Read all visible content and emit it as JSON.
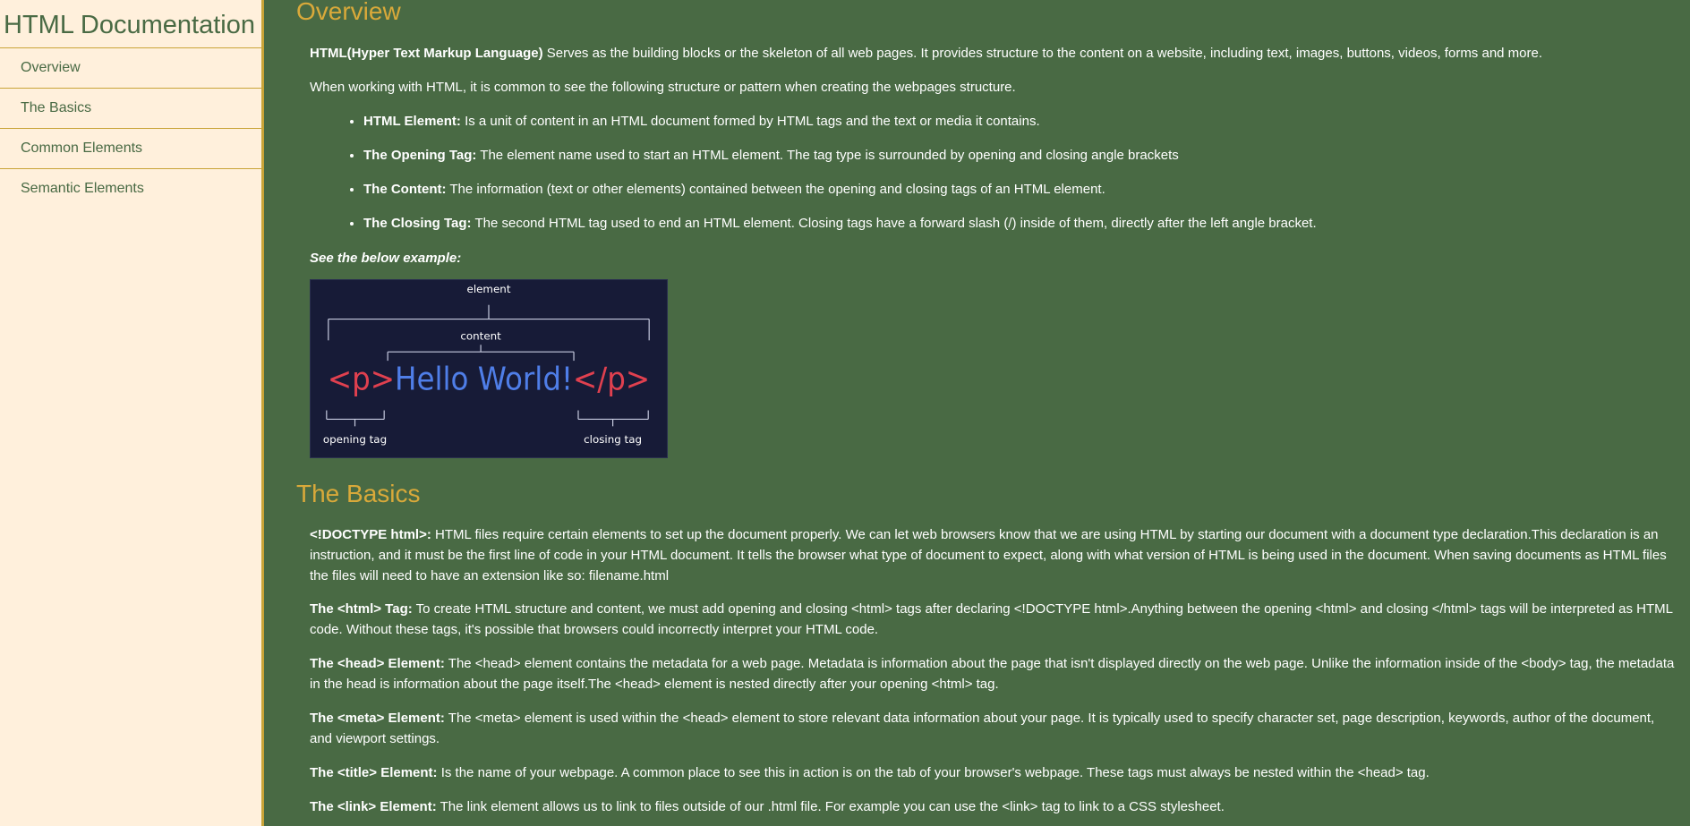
{
  "navbar": {
    "title": "HTML Documentation",
    "links": [
      {
        "label": "Overview"
      },
      {
        "label": "The Basics"
      },
      {
        "label": "Common Elements"
      },
      {
        "label": "Semantic Elements"
      }
    ]
  },
  "overview": {
    "title": "Overview",
    "intro_bold": "HTML(Hyper Text Markup Language)",
    "intro_text": " Serves as the building blocks or the skeleton of all web pages. It provides structure to the content on a website, including text, images, buttons, videos, forms and more.",
    "structure_text": "When working with HTML, it is common to see the following structure or pattern when creating the webpages structure.",
    "list": [
      {
        "bold": "HTML Element:",
        "text": " Is a unit of content in an HTML document formed by HTML tags and the text or media it contains."
      },
      {
        "bold": "The Opening Tag:",
        "text": " The element name used to start an HTML element. The tag type is surrounded by opening and closing angle brackets"
      },
      {
        "bold": "The Content:",
        "text": " The information (text or other elements) contained between the opening and closing tags of an HTML element."
      },
      {
        "bold": "The Closing Tag:",
        "text": " The second HTML tag used to end an HTML element. Closing tags have a forward slash (/) inside of them, directly after the left angle bracket."
      }
    ],
    "example_label": "See the below example:",
    "diagram": {
      "element_label": "element",
      "content_label": "content",
      "open_tag": "<p>",
      "content": "Hello World!",
      "close_tag": "</p>",
      "opening_tag_label": "opening tag",
      "closing_tag_label": "closing tag",
      "tag_color": "#e0404f",
      "content_color": "#4f7ee8"
    }
  },
  "basics": {
    "title": "The Basics",
    "paragraphs": [
      {
        "bold": "<!DOCTYPE html>:",
        "text": " HTML files require certain elements to set up the document properly. We can let web browsers know that we are using HTML by starting our document with a document type declaration.This declaration is an instruction, and it must be the first line of code in your HTML document. It tells the browser what type of document to expect, along with what version of HTML is being used in the document. When saving documents as HTML files the files will need to have an extension like so: filename.html"
      },
      {
        "bold": "The <html> Tag:",
        "text": " To create HTML structure and content, we must add opening and closing <html> tags after declaring <!DOCTYPE html>.Anything between the opening <html> and closing </html> tags will be interpreted as HTML code. Without these tags, it's possible that browsers could incorrectly interpret your HTML code."
      },
      {
        "bold": "The <head> Element:",
        "text": " The <head> element contains the metadata for a web page. Metadata is information about the page that isn't displayed directly on the web page. Unlike the information inside of the <body> tag, the metadata in the head is information about the page itself.The <head> element is nested directly after your opening <html> tag."
      },
      {
        "bold": "The <meta> Element:",
        "text": " The <meta> element is used within the <head> element to store relevant data information about your page. It is typically used to specify character set, page description, keywords, author of the document, and viewport settings."
      },
      {
        "bold": "The <title> Element:",
        "text": " Is the name of your webpage. A common place to see this in action is on the tab of your browser's webpage. These tags must always be nested within the <head> tag."
      },
      {
        "bold": "The <link> Element:",
        "text": " The link element allows us to link to files outside of our .html file. For example you can use the <link> tag to link to a CSS stylesheet."
      }
    ]
  },
  "colors": {
    "sidebar_bg": "#fff0dc",
    "main_bg": "#496a44",
    "accent": "#d9a93a",
    "diagram_bg": "#171b37"
  }
}
